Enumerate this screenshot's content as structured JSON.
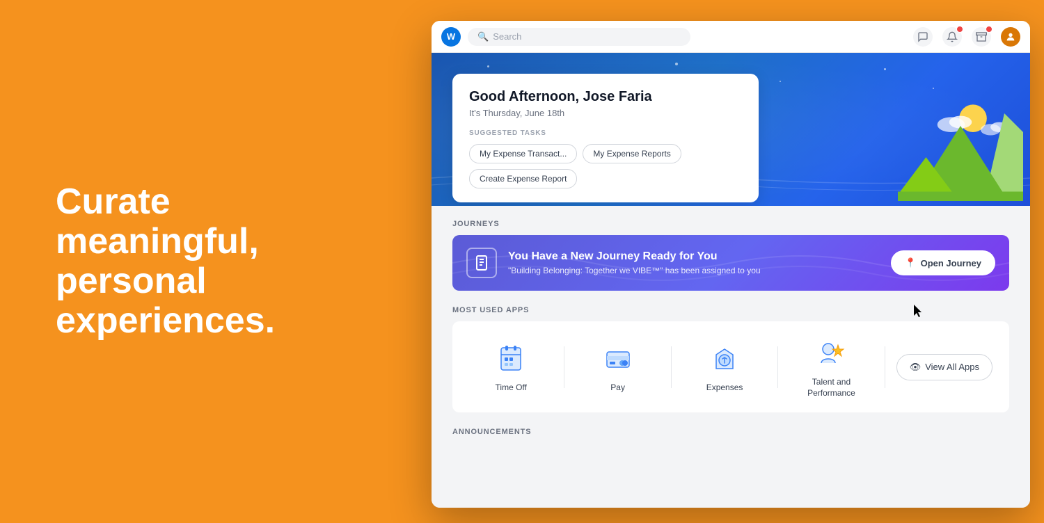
{
  "left": {
    "hero_line1": "Curate",
    "hero_line2": "meaningful,",
    "hero_line3": "personal",
    "hero_line4": "experiences."
  },
  "topbar": {
    "logo": "W",
    "search_placeholder": "Search"
  },
  "greeting": {
    "title": "Good Afternoon, Jose Faria",
    "date": "It's Thursday, June 18th",
    "suggested_tasks_label": "SUGGESTED TASKS",
    "tasks": [
      "My Expense Transact...",
      "My Expense Reports",
      "Create Expense Report"
    ]
  },
  "journeys": {
    "section_label": "JOURNEYS",
    "banner_title": "You Have a New Journey Ready for You",
    "banner_subtitle": "\"Building Belonging: Together we VIBE™\" has been assigned to you",
    "open_btn": "Open Journey"
  },
  "apps": {
    "section_label": "MOST USED APPS",
    "items": [
      {
        "label": "Time Off"
      },
      {
        "label": "Pay"
      },
      {
        "label": "Expenses"
      },
      {
        "label": "Talent and\nPerformance"
      }
    ],
    "view_all_btn": "View All Apps"
  },
  "announcements": {
    "section_label": "ANNOUNCEMENTS"
  }
}
